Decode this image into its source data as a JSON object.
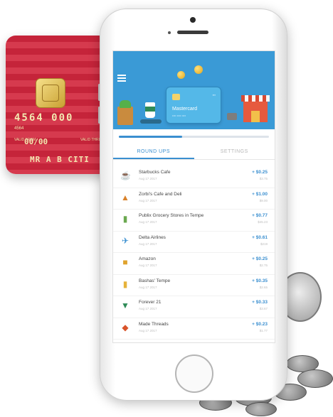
{
  "card": {
    "number": "4564 000",
    "sub_number": "4564",
    "valid_from_label": "VALID FROM",
    "valid_date": "00/00",
    "valid_thru_label": "VALID THRU",
    "holder_name": "MR A B CITI"
  },
  "app": {
    "mini_card_title": "Mastercard",
    "progress": 0.42,
    "tabs": [
      {
        "label": "ROUND UPS",
        "active": true
      },
      {
        "label": "SETTINGS",
        "active": false
      }
    ],
    "transactions": [
      {
        "name": "Starbucks Cafe",
        "date": "Aug 17 2017",
        "amount": "+ $0.25",
        "total": "$3.75",
        "icon": "coffee-icon"
      },
      {
        "name": "Zorbi's Cafe and Deli",
        "date": "Aug 17 2017",
        "amount": "+ $1.00",
        "total": "$9.00",
        "icon": "food-icon"
      },
      {
        "name": "Publix Grocery Stores in Tempe",
        "date": "Aug 17 2017",
        "amount": "+ $0.77",
        "total": "$45.23",
        "icon": "grocery-icon"
      },
      {
        "name": "Delta Airlines",
        "date": "Aug 17 2017",
        "amount": "+ $0.61",
        "total": "$219",
        "icon": "plane-icon"
      },
      {
        "name": "Amazon",
        "date": "Aug 17 2017",
        "amount": "+ $0.25",
        "total": "$2.75",
        "icon": "package-icon"
      },
      {
        "name": "Bashas' Tempe",
        "date": "Aug 17 2017",
        "amount": "+ $0.35",
        "total": "$2.65",
        "icon": "shopping-icon"
      },
      {
        "name": "Forever 21",
        "date": "Aug 17 2017",
        "amount": "+ $0.33",
        "total": "$3.67",
        "icon": "shirt-icon"
      },
      {
        "name": "Made Threads",
        "date": "Aug 17 2017",
        "amount": "+ $0.23",
        "total": "$1.77",
        "icon": "pizza-icon"
      }
    ]
  }
}
